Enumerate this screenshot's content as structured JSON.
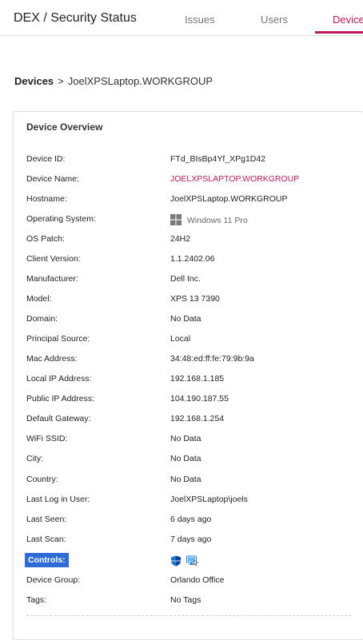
{
  "header": {
    "title": "DEX / Security Status",
    "tabs": [
      {
        "label": "Issues"
      },
      {
        "label": "Users"
      },
      {
        "label": "Device"
      }
    ],
    "active_tab_color": "#c2185b"
  },
  "breadcrumb": {
    "root": "Devices",
    "separator": ">",
    "current": "JoelXPSLaptop.WORKGROUP"
  },
  "overview": {
    "title": "Device Overview",
    "rows": {
      "device_id": {
        "label": "Device ID:",
        "value": "FTd_BIsBp4Yf_XPg1D42"
      },
      "device_name": {
        "label": "Device Name:",
        "value": "JOELXPSLAPTOP.WORKGROUP"
      },
      "hostname": {
        "label": "Hostname:",
        "value": "JoelXPSLaptop.WORKGROUP"
      },
      "os": {
        "label": "Operating System:",
        "value": "Windows 11 Pro",
        "icon": "windows-icon"
      },
      "os_patch": {
        "label": "OS Patch:",
        "value": "24H2"
      },
      "client_version": {
        "label": "Client Version:",
        "value": "1.1.2402.06"
      },
      "manufacturer": {
        "label": "Manufacturer:",
        "value": "Dell Inc."
      },
      "model": {
        "label": "Model:",
        "value": "XPS 13 7390"
      },
      "domain": {
        "label": "Domain:",
        "value": "No Data"
      },
      "principal_source": {
        "label": "Principal Source:",
        "value": "Local"
      },
      "mac_address": {
        "label": "Mac Address:",
        "value": "34:48:ed:ff:fe:79:9b:9a"
      },
      "local_ip": {
        "label": "Local IP Address:",
        "value": "192.168.1.185"
      },
      "public_ip": {
        "label": "Public IP Address:",
        "value": "104.190.187.55"
      },
      "default_gateway": {
        "label": "Default Gateway:",
        "value": "192.168.1.254"
      },
      "wifi_ssid": {
        "label": "WiFi SSID:",
        "value": "No Data"
      },
      "city": {
        "label": "City:",
        "value": "No Data"
      },
      "country": {
        "label": "Country:",
        "value": "No Data"
      },
      "last_user": {
        "label": "Last Log in User:",
        "value": "JoelXPSLaptop\\joels"
      },
      "last_seen": {
        "label": "Last Seen:",
        "value": "6 days ago"
      },
      "last_scan": {
        "label": "Last Scan:",
        "value": "7 days ago"
      },
      "controls": {
        "label": "Controls:",
        "icons": [
          "defender-shield-icon",
          "remote-desktop-icon"
        ]
      },
      "device_group": {
        "label": "Device Group:",
        "value": "Orlando Office"
      },
      "tags": {
        "label": "Tags:",
        "value": "No Tags"
      }
    }
  },
  "colors": {
    "accent": "#c2185b",
    "highlight": "#2e6bd6",
    "windows": "#7a7a7a",
    "shield": "#1976d2"
  }
}
